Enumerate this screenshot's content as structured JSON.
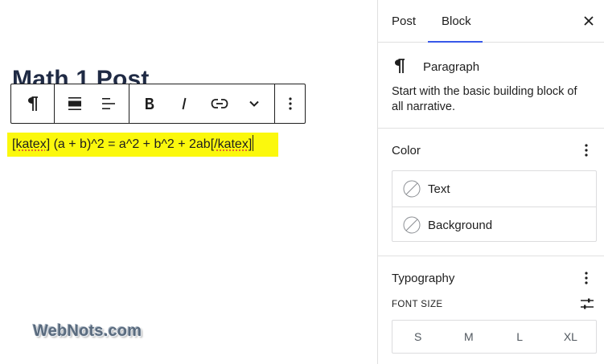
{
  "editor": {
    "post_title": "Math 1 Post",
    "paragraph": {
      "shortcode_open": "[katex]",
      "formula": " (a + b)^2 = a^2 + b^2 + 2ab",
      "shortcode_close": "[/katex]"
    },
    "highlight_color": "#fbf80d"
  },
  "toolbar": {
    "items": [
      {
        "name": "paragraph-block-icon"
      },
      {
        "name": "align-wide-icon"
      },
      {
        "name": "align-left-icon"
      },
      {
        "name": "bold-icon"
      },
      {
        "name": "italic-icon"
      },
      {
        "name": "link-icon"
      },
      {
        "name": "chevron-down-icon"
      },
      {
        "name": "more-options-icon"
      }
    ]
  },
  "watermark": "WebNots.com",
  "sidebar": {
    "tabs": [
      "Post",
      "Block"
    ],
    "active_tab": "Block",
    "accent_color": "#3858e9",
    "block": {
      "name": "Paragraph",
      "description": "Start with the basic building block of all narrative."
    },
    "color_panel": {
      "title": "Color",
      "items": [
        "Text",
        "Background"
      ]
    },
    "typography_panel": {
      "title": "Typography",
      "font_size_label": "FONT SIZE",
      "sizes": [
        "S",
        "M",
        "L",
        "XL"
      ]
    }
  }
}
